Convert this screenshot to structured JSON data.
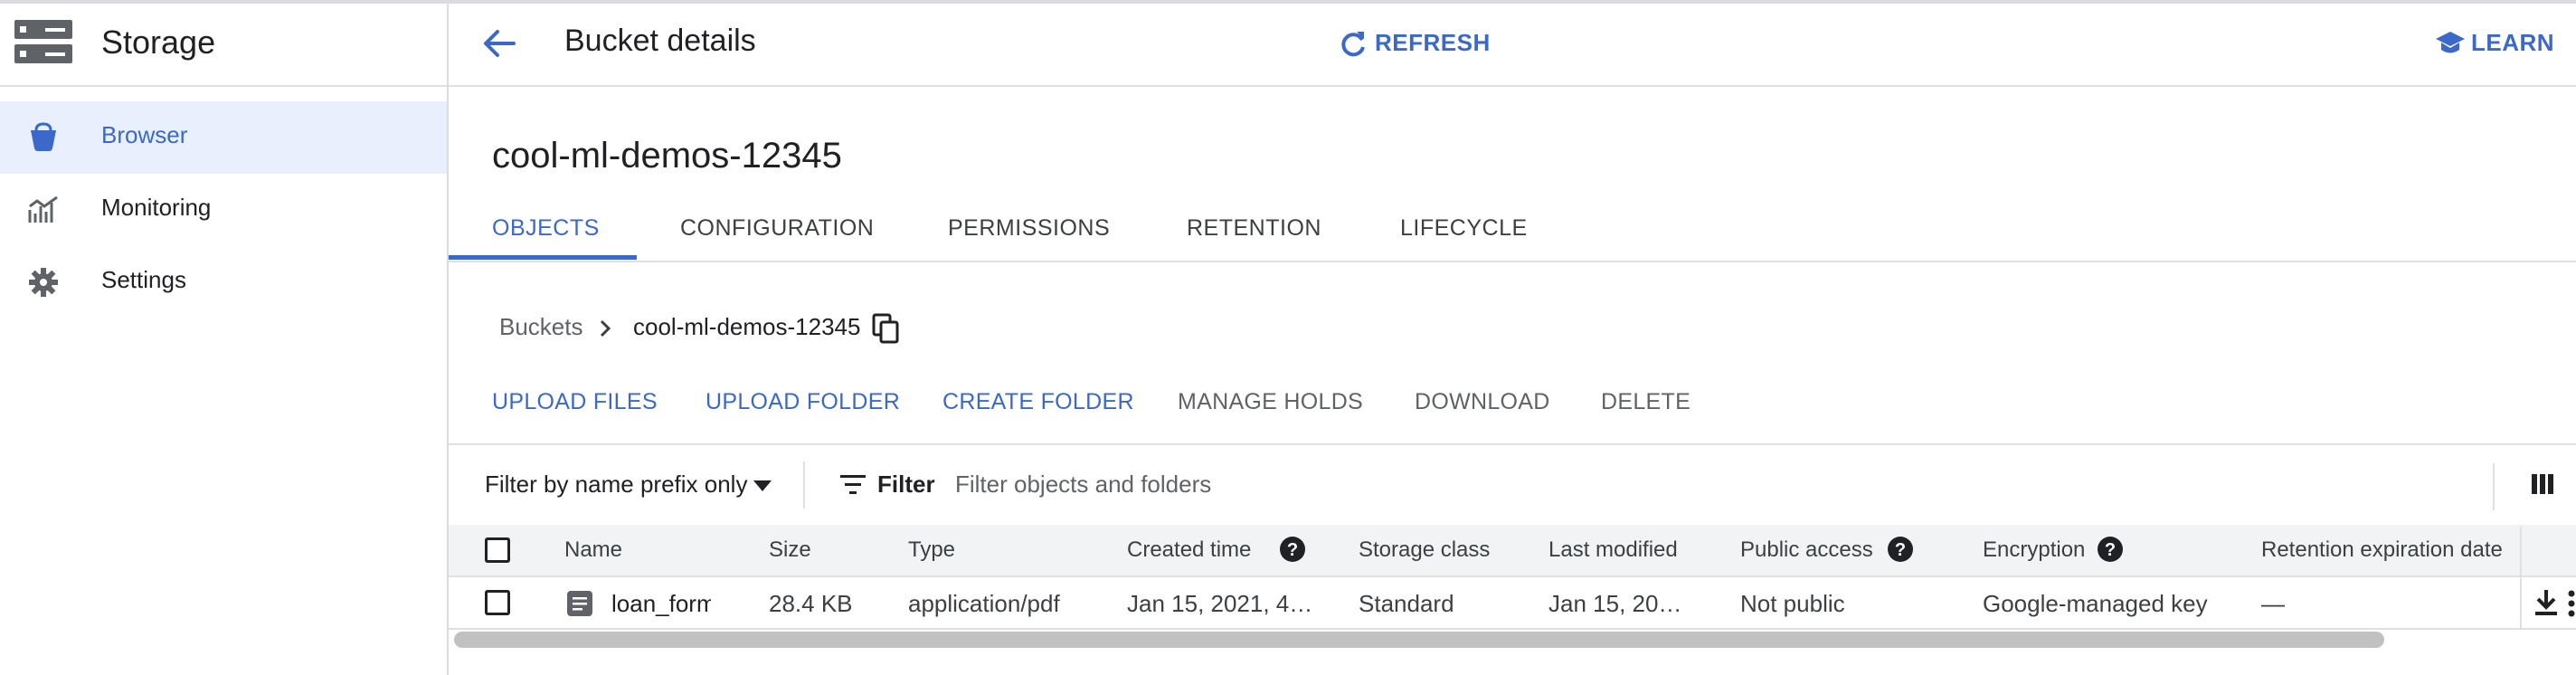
{
  "sidebar": {
    "title": "Storage",
    "items": [
      {
        "label": "Browser",
        "active": true,
        "icon": "bucket-icon"
      },
      {
        "label": "Monitoring",
        "active": false,
        "icon": "monitoring-icon"
      },
      {
        "label": "Settings",
        "active": false,
        "icon": "gear-icon"
      }
    ]
  },
  "header": {
    "title": "Bucket details",
    "refresh_label": "REFRESH",
    "learn_label": "LEARN"
  },
  "bucket_name": "cool-ml-demos-12345",
  "tabs": [
    "OBJECTS",
    "CONFIGURATION",
    "PERMISSIONS",
    "RETENTION",
    "LIFECYCLE"
  ],
  "breadcrumb": {
    "root": "Buckets",
    "current": "cool-ml-demos-12345"
  },
  "actions": [
    "UPLOAD FILES",
    "UPLOAD FOLDER",
    "CREATE FOLDER",
    "MANAGE HOLDS",
    "DOWNLOAD",
    "DELETE"
  ],
  "filter": {
    "mode": "Filter by name prefix only",
    "label": "Filter",
    "placeholder": "Filter objects and folders"
  },
  "table": {
    "columns": [
      "Name",
      "Size",
      "Type",
      "Created time",
      "Storage class",
      "Last modified",
      "Public access",
      "Encryption",
      "Retention expiration date"
    ],
    "rows": [
      {
        "name": "loan_form",
        "size": "28.4 KB",
        "type": "application/pdf",
        "created": "Jan 15, 2021, 4…",
        "storage_class": "Standard",
        "last_modified": "Jan 15, 20…",
        "public_access": "Not public",
        "encryption": "Google-managed key",
        "retention": "—"
      }
    ]
  },
  "colors": {
    "accent": "#3b68c9",
    "active_bg": "#e8f0fe",
    "border": "#e0e0e0"
  }
}
